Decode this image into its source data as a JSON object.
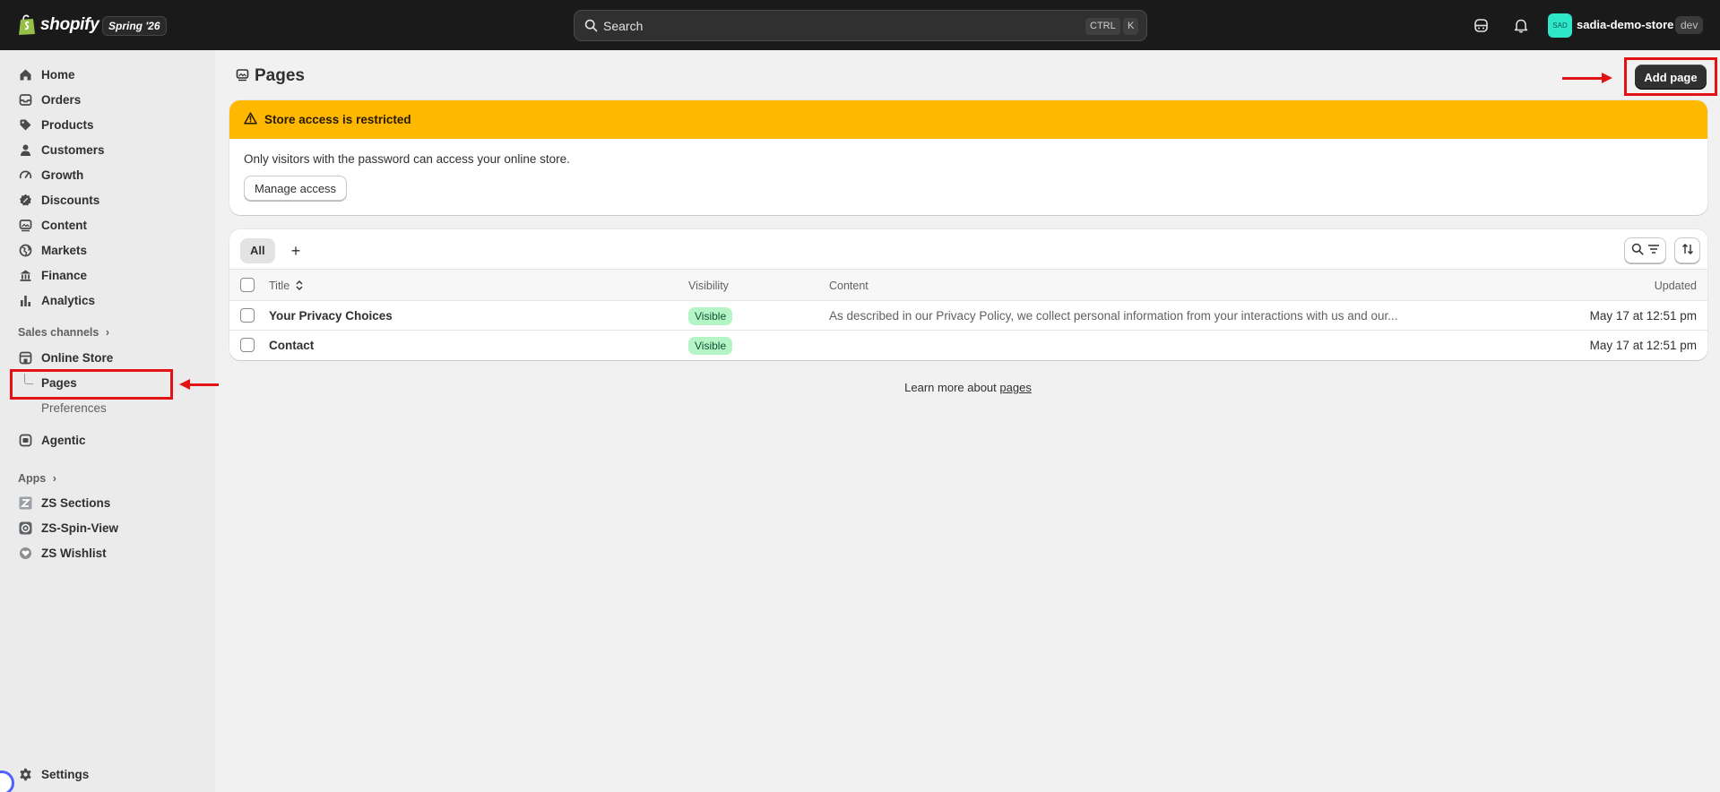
{
  "topbar": {
    "brand": "shopify",
    "edition": "Spring '26",
    "search_placeholder": "Search",
    "shortcut_ctrl": "CTRL",
    "shortcut_k": "K",
    "store_initials": "SAD",
    "store_name": "sadia-demo-store",
    "store_badge": "dev"
  },
  "sidebar": {
    "items": [
      {
        "label": "Home",
        "icon": "home-icon"
      },
      {
        "label": "Orders",
        "icon": "inbox-icon"
      },
      {
        "label": "Products",
        "icon": "tag-icon"
      },
      {
        "label": "Customers",
        "icon": "person-icon"
      },
      {
        "label": "Growth",
        "icon": "gauge-icon"
      },
      {
        "label": "Discounts",
        "icon": "discount-icon"
      },
      {
        "label": "Content",
        "icon": "image-icon"
      },
      {
        "label": "Markets",
        "icon": "globe-icon"
      },
      {
        "label": "Finance",
        "icon": "bank-icon"
      },
      {
        "label": "Analytics",
        "icon": "bar-chart-icon"
      }
    ],
    "sales_channels_label": "Sales channels",
    "online_store_label": "Online Store",
    "pages_label": "Pages",
    "preferences_label": "Preferences",
    "agentic_label": "Agentic",
    "apps_label": "Apps",
    "apps": [
      {
        "label": "ZS Sections",
        "icon": "zs-sections-icon"
      },
      {
        "label": "ZS-Spin-View",
        "icon": "zs-spin-view-icon"
      },
      {
        "label": "ZS Wishlist",
        "icon": "zs-wishlist-icon"
      }
    ],
    "settings_label": "Settings"
  },
  "main": {
    "title": "Pages",
    "add_button": "Add page",
    "banner": {
      "title": "Store access is restricted",
      "body": "Only visitors with the password can access your online store.",
      "button": "Manage access"
    },
    "tabs": {
      "all": "All",
      "add": "+"
    },
    "table": {
      "headers": {
        "title": "Title",
        "visibility": "Visibility",
        "content": "Content",
        "updated": "Updated"
      },
      "rows": [
        {
          "title": "Your Privacy Choices",
          "visibility": "Visible",
          "content": "As described in our Privacy Policy, we collect personal information from your interactions with us and our...",
          "updated": "May 17 at 12:51 pm"
        },
        {
          "title": "Contact",
          "visibility": "Visible",
          "content": "",
          "updated": "May 17 at 12:51 pm"
        }
      ]
    },
    "footer_text": "Learn more about",
    "footer_link": "pages"
  },
  "colors": {
    "topbar_bg": "#1a1a1a",
    "warning": "#ffb800",
    "success_badge_bg": "#b5f5c5",
    "highlight": "#e41313",
    "primary_button": "#303030"
  }
}
